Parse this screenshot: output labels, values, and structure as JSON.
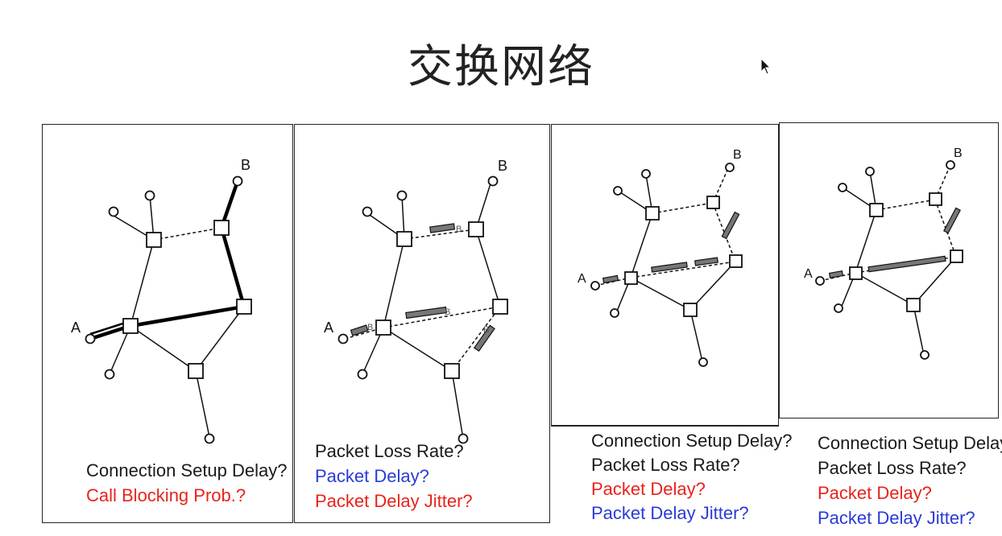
{
  "title": "交换网络",
  "node_labels": {
    "a": "A",
    "b": "B"
  },
  "packet_label": "B",
  "panel1": {
    "lines": [
      "Connection Setup Delay?",
      "Call Blocking Prob.?"
    ]
  },
  "panel2": {
    "lines": [
      "Packet Loss Rate?",
      "Packet Delay?",
      "Packet Delay Jitter?"
    ]
  },
  "panel3": {
    "lines": [
      "Connection Setup Delay?",
      "Packet Loss Rate?",
      "Packet Delay?",
      "Packet Delay Jitter?"
    ]
  },
  "panel4": {
    "lines": [
      "Connection Setup Delay?",
      "Packet Loss Rate?",
      "Packet Delay?",
      "Packet Delay Jitter?"
    ]
  },
  "colors": {
    "black": "#1a1a1a",
    "red": "#e8231b",
    "blue": "#2a3bd6"
  }
}
